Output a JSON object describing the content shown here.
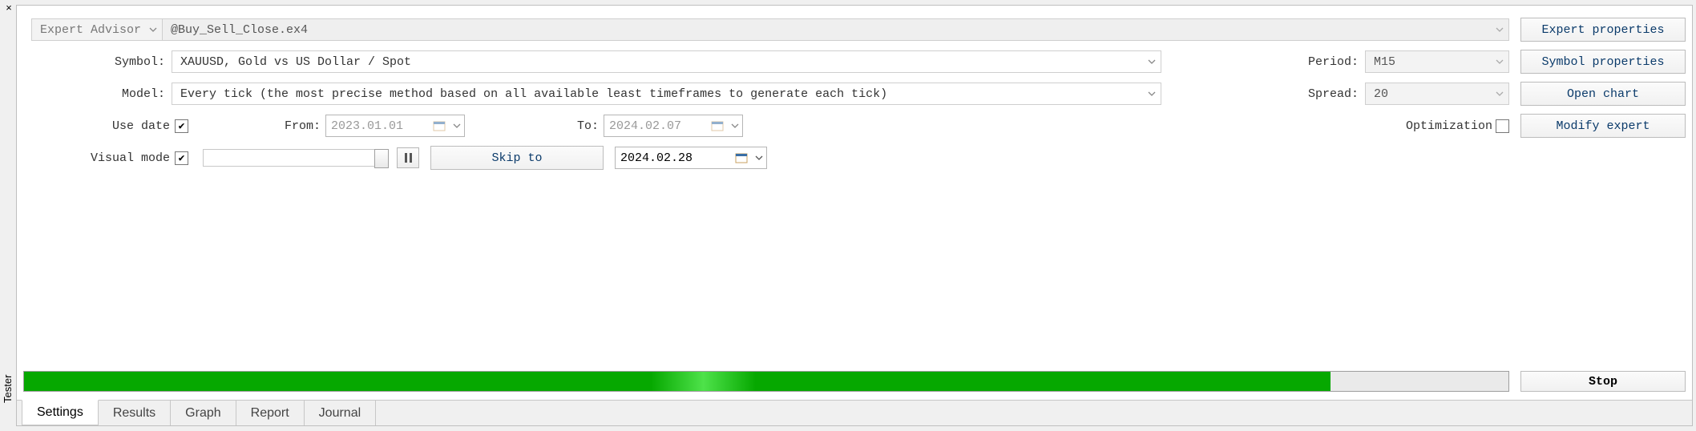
{
  "side_tab_label": "Tester",
  "row1": {
    "label": "Expert Advisor",
    "file": "@Buy_Sell_Close.ex4"
  },
  "row2": {
    "symbol_label": "Symbol:",
    "symbol_value": "XAUUSD, Gold vs US Dollar / Spot",
    "period_label": "Period:",
    "period_value": "M15"
  },
  "row3": {
    "model_label": "Model:",
    "model_value": "Every tick (the most precise method based on all available least timeframes to generate each tick)",
    "spread_label": "Spread:",
    "spread_value": "20"
  },
  "row4": {
    "use_date_label": "Use date",
    "from_label": "From:",
    "from_value": "2023.01.01",
    "to_label": "To:",
    "to_value": "2024.02.07",
    "optimization_label": "Optimization"
  },
  "row5": {
    "visual_label": "Visual mode",
    "skip_label": "Skip to",
    "skip_date": "2024.02.28"
  },
  "buttons": {
    "expert_props": "Expert properties",
    "symbol_props": "Symbol properties",
    "open_chart": "Open chart",
    "modify_expert": "Modify expert",
    "stop": "Stop"
  },
  "progress_percent": 88,
  "tabs": {
    "settings": "Settings",
    "results": "Results",
    "graph": "Graph",
    "report": "Report",
    "journal": "Journal"
  }
}
